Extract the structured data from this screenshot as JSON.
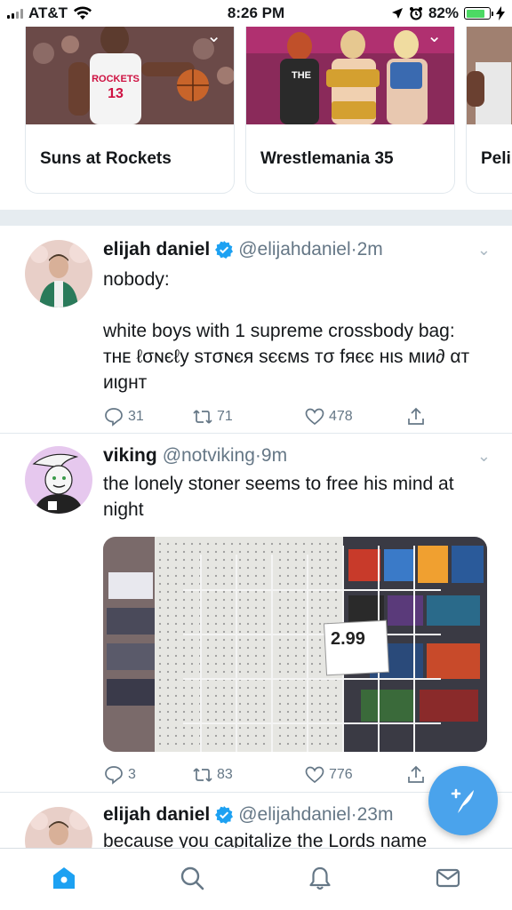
{
  "status_bar": {
    "carrier": "AT&T",
    "time": "8:26 PM",
    "battery": "82%",
    "battery_level": 0.82,
    "icons": [
      "signal-icon",
      "wifi-icon",
      "location-icon",
      "alarm-icon",
      "battery-icon",
      "charging-icon"
    ]
  },
  "moments": [
    {
      "title": "Suns at Rockets"
    },
    {
      "title": "Wrestlemania 35"
    },
    {
      "title": "Peli"
    }
  ],
  "tweets": [
    {
      "name": "elijah daniel",
      "verified": true,
      "handle": "@elijahdaniel",
      "dot": "·",
      "time": "2m",
      "text": "nobody:\n\nwhite boys with 1 supreme crossbody bag:\nᴛʜᴇ ℓσɴєℓу ѕтσɴєя ѕєємѕ тσ fяєє нιѕ мιи∂ αт иιgнт",
      "replies": "31",
      "retweets": "71",
      "likes": "478"
    },
    {
      "name": "viking",
      "verified": false,
      "handle": "@notviking",
      "dot": "·",
      "time": "9m",
      "text": "the lonely stoner seems to free his mind at night",
      "media_price": "2.99",
      "replies": "3",
      "retweets": "83",
      "likes": "776"
    },
    {
      "name": "elijah daniel",
      "verified": true,
      "handle": "@elijahdaniel",
      "dot": "·",
      "time": "23m",
      "text": "because you capitalize the Lords name"
    }
  ],
  "tabbar": {
    "tabs": [
      "home-tab",
      "search-tab",
      "notifications-tab",
      "messages-tab"
    ],
    "active": "home-tab"
  },
  "colors": {
    "brand": "#1da1f2",
    "fab": "#4aa3ec",
    "muted": "#657786",
    "verified": "#1da1f2",
    "separator": "#e6ecf0"
  }
}
